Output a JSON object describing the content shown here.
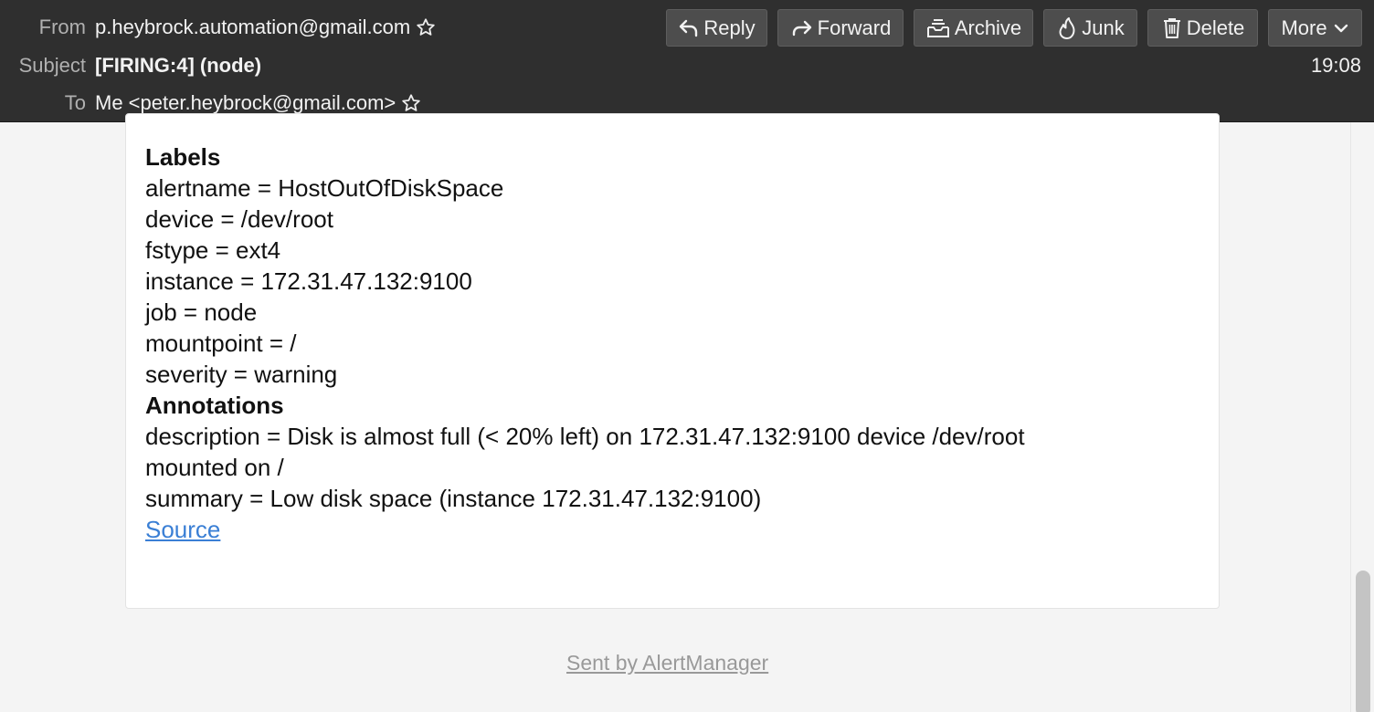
{
  "header": {
    "from_label": "From",
    "from_value": "p.heybrock.automation@gmail.com",
    "subject_label": "Subject",
    "subject_value": "[FIRING:4] (node)",
    "to_label": "To",
    "to_value": "Me <peter.heybrock@gmail.com>",
    "time": "19:08"
  },
  "toolbar": {
    "reply": "Reply",
    "forward": "Forward",
    "archive": "Archive",
    "junk": "Junk",
    "delete": "Delete",
    "more": "More"
  },
  "message": {
    "labels_heading": "Labels",
    "labels": [
      "alertname = HostOutOfDiskSpace",
      "device = /dev/root",
      "fstype = ext4",
      "instance = 172.31.47.132:9100",
      "job = node",
      "mountpoint = /",
      "severity = warning"
    ],
    "annotations_heading": "Annotations",
    "annotations": [
      "description = Disk is almost full (< 20% left) on 172.31.47.132:9100 device /dev/root",
      "mounted on /",
      "summary = Low disk space (instance 172.31.47.132:9100)"
    ],
    "source_link": "Source"
  },
  "footer": {
    "sent_by": "Sent by AlertManager"
  }
}
